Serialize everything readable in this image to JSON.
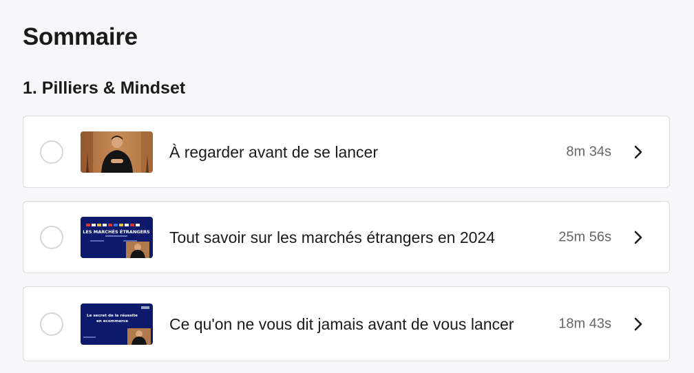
{
  "heading": "Sommaire",
  "section": {
    "title": "1. Pilliers & Mindset"
  },
  "lessons": [
    {
      "title": "À regarder avant de se lancer",
      "duration": "8m 34s",
      "thumbnail": "presenter-video-thumbnail"
    },
    {
      "title": "Tout savoir sur les marchés étrangers en 2024",
      "duration": "25m 56s",
      "thumbnail": "slide-thumbnail",
      "thumbnail_text": "LES MARCHÉS ÉTRANGERS"
    },
    {
      "title": "Ce qu'on ne vous dit jamais avant de vous lancer",
      "duration": "18m 43s",
      "thumbnail": "slide-thumbnail",
      "thumbnail_text": "Le secret de la réussite en ecommerce"
    }
  ],
  "colors": {
    "background": "#f7f7f9",
    "card": "#ffffff",
    "border": "#dcdcdf",
    "muted_text": "#666668",
    "slide_blue": "#0d1a6b"
  }
}
